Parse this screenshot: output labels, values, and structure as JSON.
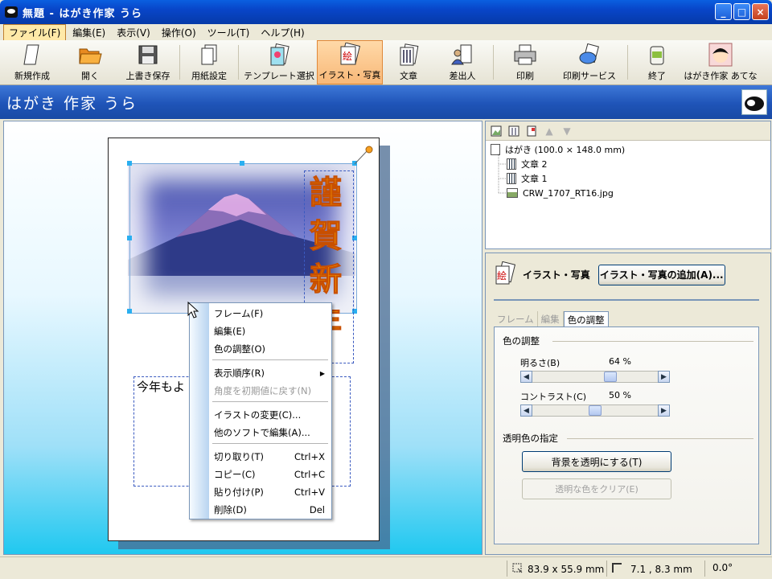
{
  "window": {
    "title": "無題 - はがき作家 うら",
    "minimize": "_",
    "maximize": "□",
    "close": "×"
  },
  "menu": [
    {
      "label": "ファイル(F)",
      "active": true
    },
    {
      "label": "編集(E)"
    },
    {
      "label": "表示(V)"
    },
    {
      "label": "操作(O)"
    },
    {
      "label": "ツール(T)"
    },
    {
      "label": "ヘルプ(H)"
    }
  ],
  "toolbar": {
    "new": "新規作成",
    "open": "開く",
    "save": "上書き保存",
    "paper": "用紙設定",
    "template": "テンプレート選択",
    "illust": "イラスト・写真",
    "text": "文章",
    "sender": "差出人",
    "print": "印刷",
    "print_service": "印刷サービス",
    "exit": "終了",
    "switch": "はがき作家 あてな"
  },
  "header": {
    "title": "はがき 作家 うら"
  },
  "canvas": {
    "greeting_chars": [
      "謹",
      "賀",
      "新",
      "年"
    ],
    "body_text": "今年もよ"
  },
  "context_menu": {
    "frame": "フレーム(F)",
    "edit": "編集(E)",
    "color_adjust": "色の調整(O)",
    "order": "表示順序(R)",
    "reset_angle": "角度を初期値に戻す(N)",
    "change_illust": "イラストの変更(C)...",
    "edit_other": "他のソフトで編集(A)...",
    "cut": "切り取り(T)",
    "cut_sc": "Ctrl+X",
    "copy": "コピー(C)",
    "copy_sc": "Ctrl+C",
    "paste": "貼り付け(P)",
    "paste_sc": "Ctrl+V",
    "delete": "削除(D)",
    "delete_sc": "Del"
  },
  "tree": {
    "root": "はがき (100.0 × 148.0 mm)",
    "items": [
      "文章 2",
      "文章 1",
      "CRW_1707_RT16.jpg"
    ]
  },
  "props": {
    "title": "イラスト・写真",
    "add_button": "イラスト・写真の追加(A)...",
    "tabs": [
      "フレーム",
      "編集",
      "色の調整"
    ],
    "color_group": "色の調整",
    "brightness_label": "明るさ(B)",
    "brightness_value": "64 %",
    "brightness": 64,
    "contrast_label": "コントラスト(C)",
    "contrast_value": "50 %",
    "contrast": 50,
    "transparent_group": "透明色の指定",
    "transparent_button": "背景を透明にする(T)",
    "clear_button": "透明な色をクリア(E)"
  },
  "status": {
    "size": "83.9 x 55.9 mm",
    "position": "7.1 ,  8.3 mm",
    "angle": "0.0°"
  },
  "colors": {
    "accent": "#0845c8",
    "greeting": "#f7a000",
    "selection": "#2aaff0"
  }
}
